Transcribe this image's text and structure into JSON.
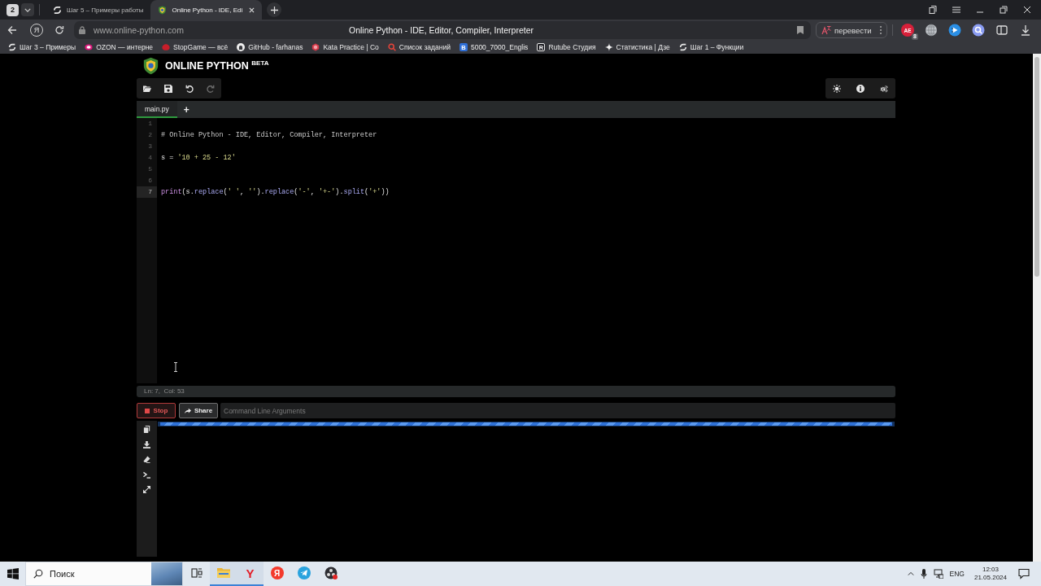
{
  "browser": {
    "tab_counter": "2",
    "tabs": [
      {
        "kind": "stepik",
        "title": "Шаг 5 – Примеры работы",
        "selected": false
      },
      {
        "kind": "python",
        "title": "Online Python - IDE, Edi",
        "selected": true
      }
    ],
    "address_bar": {
      "logo_button": "Я",
      "url": "www.online-python.com",
      "page_title": "Online Python - IDE, Editor, Compiler, Interpreter"
    },
    "translate_button": "перевести",
    "extension": {
      "label": "AE",
      "count": "8"
    },
    "bookmarks": [
      {
        "kind": "stepik",
        "title": "Шаг 3 – Примеры"
      },
      {
        "kind": "ozon",
        "title": "OZON — интерне"
      },
      {
        "kind": "stopgame",
        "title": "StopGame — всё"
      },
      {
        "kind": "github",
        "title": "GitHub - farhanas"
      },
      {
        "kind": "kata",
        "title": "Kata Practice | Co"
      },
      {
        "kind": "search",
        "title": "Список заданий"
      },
      {
        "kind": "doc",
        "letter": "B",
        "title": "5000_7000_Englis"
      },
      {
        "kind": "rutube",
        "letter": "R",
        "title": "Rutube Студия"
      },
      {
        "kind": "sparkle",
        "title": "Статистика | Дзе"
      },
      {
        "kind": "stepik",
        "title": "Шаг 1 – Функции"
      }
    ]
  },
  "app": {
    "logo": "ONLINE PYTHON $^{BETA}$",
    "toolbar_left": [
      {
        "kind": "open",
        "disabled": false
      },
      {
        "kind": "save",
        "disabled": false
      },
      {
        "kind": "undo",
        "disabled": false
      },
      {
        "kind": "redo",
        "disabled": true
      }
    ],
    "toolbar_right": [
      {
        "kind": "theme"
      },
      {
        "kind": "info"
      },
      {
        "kind": "settings"
      }
    ],
    "file_tabs": [
      {
        "label": "main.py",
        "selected": true
      }
    ],
    "add_tab": "+",
    "code_lines": [
      {
        "number": "1",
        "current": false
      },
      {
        "number": "2",
        "current": false,
        "tokens": [
          {
            "kind": "comment",
            "text": "# Online Python - IDE, Editor, Compiler, Interpreter"
          }
        ]
      },
      {
        "number": "3",
        "current": false
      },
      {
        "number": "4",
        "current": false,
        "tokens": [
          {
            "kind": "plain",
            "text": "s = "
          },
          {
            "kind": "string",
            "text": "'10 + 25 - 12'"
          }
        ]
      },
      {
        "number": "5",
        "current": false
      },
      {
        "number": "6",
        "current": false
      },
      {
        "number": "7",
        "current": true,
        "tokens": [
          {
            "kind": "builtin",
            "text": "print"
          },
          {
            "kind": "plain",
            "text": "(s."
          },
          {
            "kind": "method",
            "text": "replace"
          },
          {
            "kind": "plain",
            "text": "("
          },
          {
            "kind": "string",
            "text": "' '"
          },
          {
            "kind": "plain",
            "text": ", "
          },
          {
            "kind": "string",
            "text": "''"
          },
          {
            "kind": "plain",
            "text": ")."
          },
          {
            "kind": "method",
            "text": "replace"
          },
          {
            "kind": "plain",
            "text": "("
          },
          {
            "kind": "string",
            "text": "'-'"
          },
          {
            "kind": "plain",
            "text": ", "
          },
          {
            "kind": "string",
            "text": "'+-'"
          },
          {
            "kind": "plain",
            "text": ")."
          },
          {
            "kind": "method",
            "text": "split"
          },
          {
            "kind": "plain",
            "text": "("
          },
          {
            "kind": "string",
            "text": "'+'"
          },
          {
            "kind": "plain",
            "text": "))"
          }
        ]
      }
    ],
    "status": "Ln: 7,  Col: 53",
    "run_bar": {
      "stop": "Stop",
      "share": "Share",
      "arguments_placeholder": "Command Line Arguments"
    },
    "output_tools": [
      {
        "kind": "copy"
      },
      {
        "kind": "download"
      },
      {
        "kind": "clear"
      },
      {
        "kind": "terminal"
      },
      {
        "kind": "expand"
      }
    ],
    "output_progress": {
      "level": 1
    }
  },
  "taskbar": {
    "search_placeholder": "Поиск",
    "apps": [
      {
        "kind": "task-view",
        "running": false
      },
      {
        "kind": "folder",
        "running": true
      },
      {
        "kind": "browser",
        "label": "Y",
        "running": true
      },
      {
        "kind": "yandex",
        "label": "Я",
        "running": false
      },
      {
        "kind": "telegram",
        "running": false
      },
      {
        "kind": "obs",
        "running": false
      }
    ],
    "language": "ENG",
    "time": "12:03",
    "date": "21.05.2024"
  }
}
